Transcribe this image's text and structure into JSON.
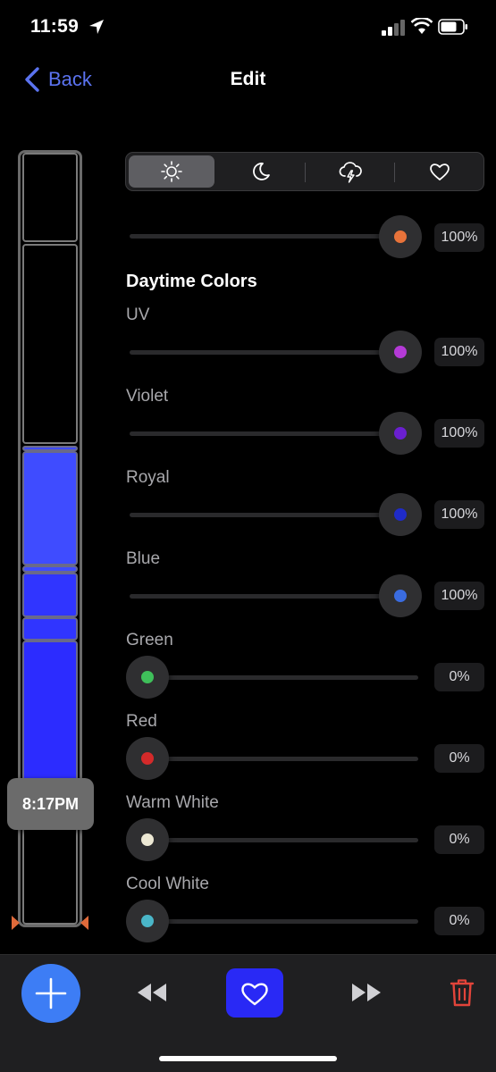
{
  "status_bar": {
    "time": "11:59"
  },
  "nav": {
    "back_label": "Back",
    "title": "Edit"
  },
  "timeline": {
    "current_time": "8:17PM"
  },
  "mode_tabs": [
    {
      "icon": "sun-icon",
      "selected": true
    },
    {
      "icon": "moon-icon",
      "selected": false
    },
    {
      "icon": "storm-icon",
      "selected": false
    },
    {
      "icon": "heart-icon",
      "selected": false
    }
  ],
  "top_slider": {
    "value": "100%",
    "color": "#e8733a",
    "level": 1.0
  },
  "section_title": "Daytime Colors",
  "channels": [
    {
      "label": "UV",
      "value": "100%",
      "color": "#b43ad6",
      "level": 1.0
    },
    {
      "label": "Violet",
      "value": "100%",
      "color": "#6a1fd0",
      "level": 1.0
    },
    {
      "label": "Royal",
      "value": "100%",
      "color": "#1f2bc8",
      "level": 1.0
    },
    {
      "label": "Blue",
      "value": "100%",
      "color": "#3a6ce0",
      "level": 1.0
    },
    {
      "label": "Green",
      "value": "0%",
      "color": "#3fbf5a",
      "level": 0.0
    },
    {
      "label": "Red",
      "value": "0%",
      "color": "#d42a2a",
      "level": 0.0
    },
    {
      "label": "Warm White",
      "value": "0%",
      "color": "#ece8d4",
      "level": 0.0
    },
    {
      "label": "Cool White",
      "value": "0%",
      "color": "#4ab6c8",
      "level": 0.0
    }
  ],
  "colors": {
    "accent": "#5b73f0",
    "add_button": "#3d7df5",
    "favorite_button": "#2929f5",
    "delete": "#e2443a"
  }
}
